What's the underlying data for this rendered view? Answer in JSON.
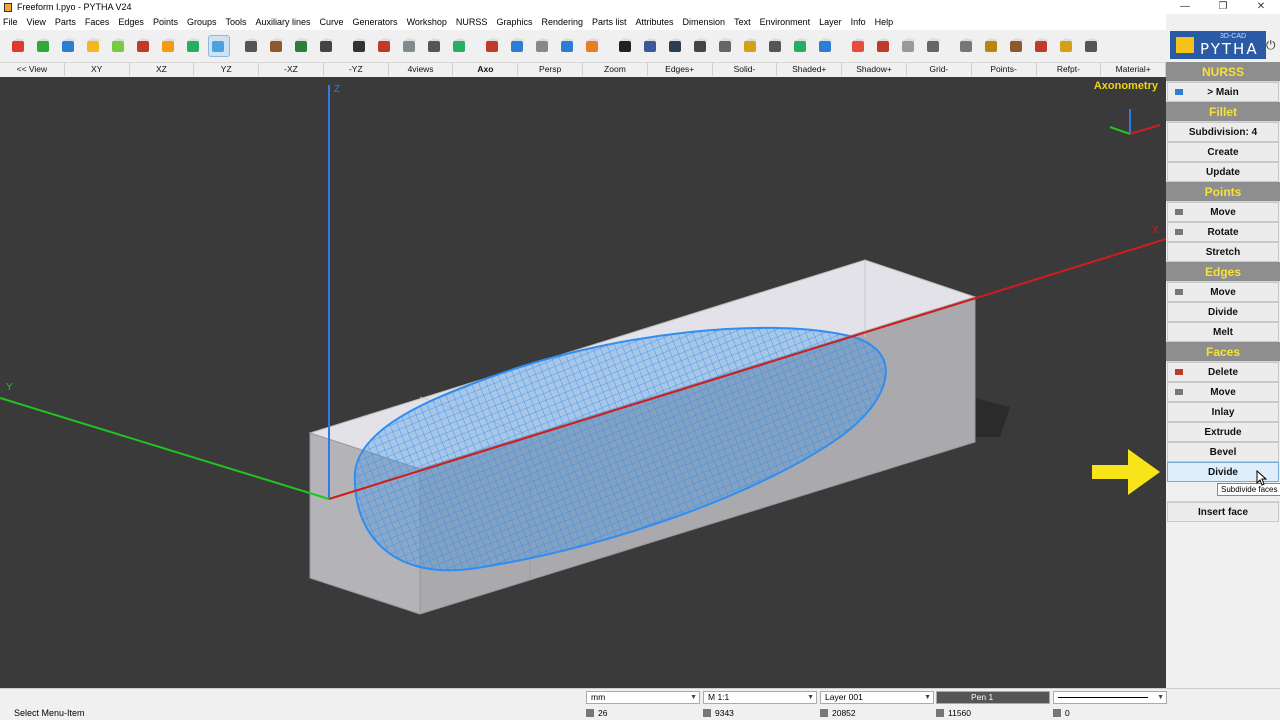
{
  "window": {
    "title": "Freeform I.pyo - PYTHA V24",
    "controls": [
      "—",
      "❐",
      "✕"
    ]
  },
  "menu": [
    "File",
    "View",
    "Parts",
    "Faces",
    "Edges",
    "Points",
    "Groups",
    "Tools",
    "Auxiliary lines",
    "Curve",
    "Generators",
    "Workshop",
    "NURSS",
    "Graphics",
    "Rendering",
    "Parts list",
    "Attributes",
    "Dimension",
    "Text",
    "Environment",
    "Layer",
    "Info",
    "Help"
  ],
  "toolbar": {
    "icons": [
      "parts-cube-icon",
      "folder-icon",
      "triangle-icon",
      "star-icon",
      "circle-icon",
      "curve-icon",
      "gear-icon",
      "brush-icon",
      "freeform-icon",
      "hammer-icon",
      "hammer2-icon",
      "hammer3-icon",
      "compass-icon",
      "camera-icon",
      "bug-icon",
      "eye-icon",
      "printer-icon",
      "export-icon",
      "import-icon",
      "hook-icon",
      "cup-icon",
      "undo-icon",
      "redo-icon",
      "attribute-icon",
      "document-icon",
      "list-icon",
      "counter-icon",
      "copy-icon",
      "hatch-icon",
      "layers-icon",
      "tree-icon",
      "info-icon",
      "lifebuoy-icon",
      "delete-icon",
      "move-parts-icon",
      "group-icon",
      "ungroup-icon",
      "workshop-icon",
      "saw-icon",
      "drill-icon",
      "tool-icon",
      "arrange-icon"
    ],
    "selected_index": 8
  },
  "viewbar": [
    {
      "label": "<< View",
      "bold": false
    },
    {
      "label": "XY",
      "bold": false
    },
    {
      "label": "XZ",
      "bold": false
    },
    {
      "label": "YZ",
      "bold": false
    },
    {
      "label": "-XZ",
      "bold": false
    },
    {
      "label": "-YZ",
      "bold": false
    },
    {
      "label": "4views",
      "bold": false
    },
    {
      "label": "Axo",
      "bold": true
    },
    {
      "label": "Persp",
      "bold": false
    },
    {
      "label": "Zoom",
      "bold": false
    },
    {
      "label": "Edges+",
      "bold": false
    },
    {
      "label": "Solid-",
      "bold": false
    },
    {
      "label": "Shaded+",
      "bold": false
    },
    {
      "label": "Shadow+",
      "bold": false
    },
    {
      "label": "Grid-",
      "bold": false
    },
    {
      "label": "Points-",
      "bold": false
    },
    {
      "label": "Refpt-",
      "bold": false
    },
    {
      "label": "Material+",
      "bold": false
    }
  ],
  "viewport": {
    "view_name": "Axonometry",
    "axes": {
      "z": "Z",
      "y": "Y",
      "x": "X"
    },
    "colors": {
      "background": "#3a3a3a",
      "x_axis": "#d01c1c",
      "y_axis": "#1fc41f",
      "z_axis": "#2d7de0",
      "mesh": "#2f8ef0",
      "label": "#f2d21a"
    }
  },
  "sidebar": {
    "logo_small": "3D-CAD",
    "logo_big": "PYTHA",
    "rows": [
      {
        "label": "NURSS",
        "type": "header"
      },
      {
        "label": "> Main",
        "type": "btn",
        "icon": "home-icon"
      },
      {
        "label": "Fillet",
        "type": "header"
      },
      {
        "label": "Subdivision: 4",
        "type": "btn"
      },
      {
        "label": "Create",
        "type": "btn"
      },
      {
        "label": "Update",
        "type": "btn"
      },
      {
        "label": "Points",
        "type": "header"
      },
      {
        "label": "Move",
        "type": "btn",
        "icon": "move-points-icon"
      },
      {
        "label": "Rotate",
        "type": "btn",
        "icon": "rotate-points-icon"
      },
      {
        "label": "Stretch",
        "type": "btn"
      },
      {
        "label": "Edges",
        "type": "header"
      },
      {
        "label": "Move",
        "type": "btn",
        "icon": "move-edges-icon"
      },
      {
        "label": "Divide",
        "type": "btn"
      },
      {
        "label": "Melt",
        "type": "btn"
      },
      {
        "label": "Faces",
        "type": "header"
      },
      {
        "label": "Delete",
        "type": "btn",
        "icon": "delete-face-icon"
      },
      {
        "label": "Move",
        "type": "btn",
        "icon": "move-face-icon"
      },
      {
        "label": "Inlay",
        "type": "btn"
      },
      {
        "label": "Extrude",
        "type": "btn"
      },
      {
        "label": "Bevel",
        "type": "btn"
      },
      {
        "label": "Divide",
        "type": "btn",
        "highlight": true
      },
      {
        "label": "",
        "type": "plain"
      },
      {
        "label": "Insert face",
        "type": "btn"
      }
    ],
    "tooltip": "Subdivide faces"
  },
  "status": {
    "message": "Select Menu-Item",
    "unit": "mm",
    "scale": "M 1:1",
    "layer": "Layer 001",
    "pen": "Pen 1",
    "counts": [
      {
        "name": "parts-count",
        "value": "26"
      },
      {
        "name": "edges-count",
        "value": "9343"
      },
      {
        "name": "faces-count",
        "value": "20852"
      },
      {
        "name": "points-count",
        "value": "11560"
      },
      {
        "name": "selected-count",
        "value": "0"
      }
    ]
  }
}
